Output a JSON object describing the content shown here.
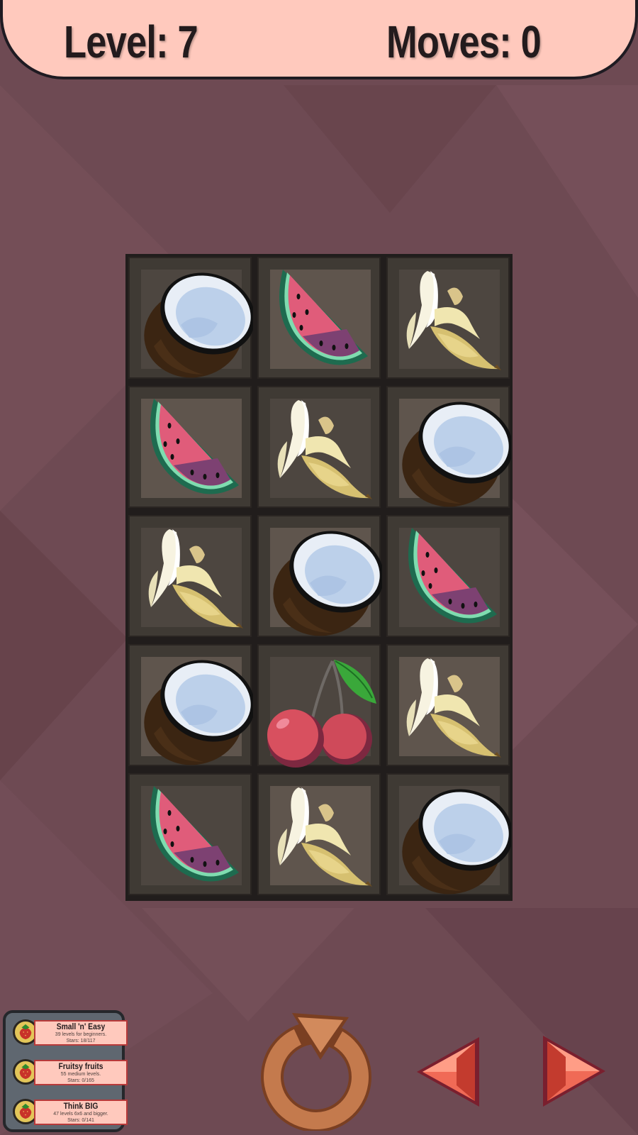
{
  "hud": {
    "level": "Level: 7",
    "moves": "Moves: 0"
  },
  "board": {
    "rows": 5,
    "cols": 3,
    "cells": [
      [
        "coconut",
        "watermelon",
        "banana"
      ],
      [
        "watermelon",
        "banana",
        "coconut"
      ],
      [
        "banana",
        "coconut",
        "watermelon"
      ],
      [
        "coconut",
        "cherry",
        "banana"
      ],
      [
        "watermelon",
        "banana",
        "coconut"
      ]
    ]
  },
  "packs": [
    {
      "title": "Small 'n' Easy",
      "desc": "39 levels for beginners.",
      "stars": "Stars: 18/117"
    },
    {
      "title": "Fruitsy fruits",
      "desc": "55 medium levels.",
      "stars": "Stars: 0/165"
    },
    {
      "title": "Think BIG",
      "desc": "47 levels 6x6 and bigger.",
      "stars": "Stars: 0/141"
    }
  ],
  "controls": {
    "restart_icon": "restart-icon",
    "prev_icon": "arrow-left-icon",
    "next_icon": "arrow-right-icon"
  },
  "colors": {
    "background": "#6e4a53",
    "header": "#ffc9bd",
    "board": "#211d1c",
    "restart": "#c47a4d",
    "arrows": "#f06a56"
  }
}
